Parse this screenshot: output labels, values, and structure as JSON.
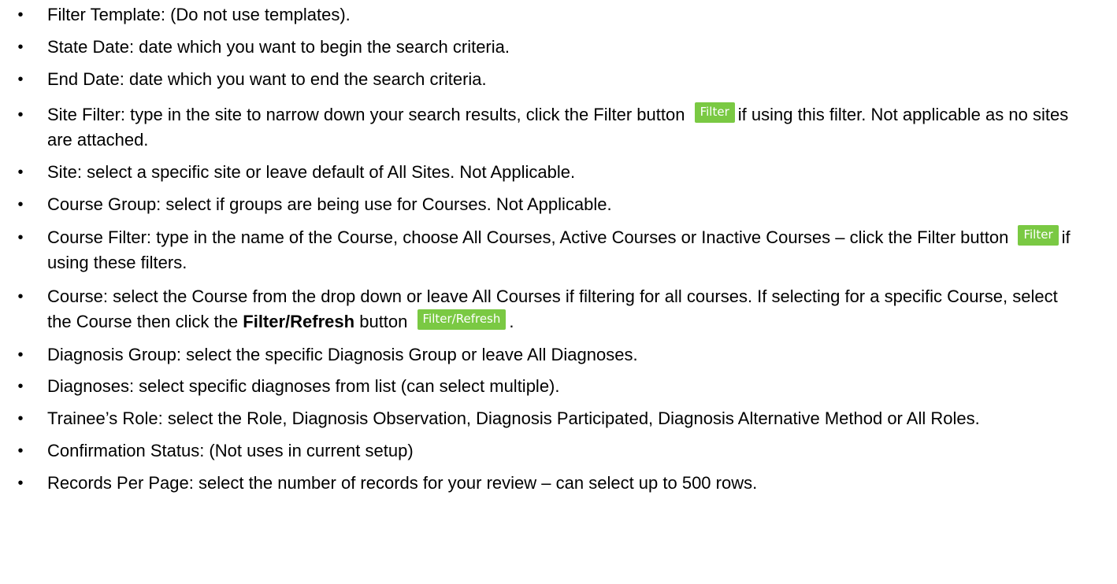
{
  "items": [
    {
      "text": "Filter Template: (Do not use templates)."
    },
    {
      "text": "State Date: date which you want to begin the search criteria."
    },
    {
      "text": "End Date: date which you want to end the search criteria."
    },
    {
      "before": "Site Filter: type in the site to narrow down your search results, click the Filter button",
      "after": "if using this filter. Not applicable as no sites are attached."
    },
    {
      "text": "Site: select a specific site or leave default of All Sites. Not Applicable."
    },
    {
      "text": "Course Group: select if groups are being use for Courses. Not Applicable."
    },
    {
      "before": "Course Filter: type in the name of the Course, choose All Courses, Active Courses or Inactive Courses – click the Filter button",
      "after": "if using these filters."
    },
    {
      "before": "Course: select the Course from the drop down or leave All Courses if filtering for all courses. If selecting for a specific Course, select the Course then click the",
      "bold": "Filter/Refresh",
      "after_bold": "button",
      "after": "."
    },
    {
      "text": "Diagnosis Group: select the specific Diagnosis Group or leave All Diagnoses."
    },
    {
      "text": "Diagnoses: select specific diagnoses from list (can select multiple)."
    },
    {
      "text": "Trainee’s Role: select the Role, Diagnosis Observation, Diagnosis Participated, Diagnosis Alternative Method or All Roles."
    },
    {
      "text": "Confirmation Status: (Not uses in current setup)"
    },
    {
      "text": "Records Per Page: select the number of records for your review – can select up to 500 rows."
    }
  ],
  "buttons": {
    "filter": "Filter",
    "filter_refresh": "Filter/Refresh"
  },
  "bullet_glyph": "•",
  "colors": {
    "button_bg": "#7ac943",
    "button_text": "#ffffff"
  }
}
